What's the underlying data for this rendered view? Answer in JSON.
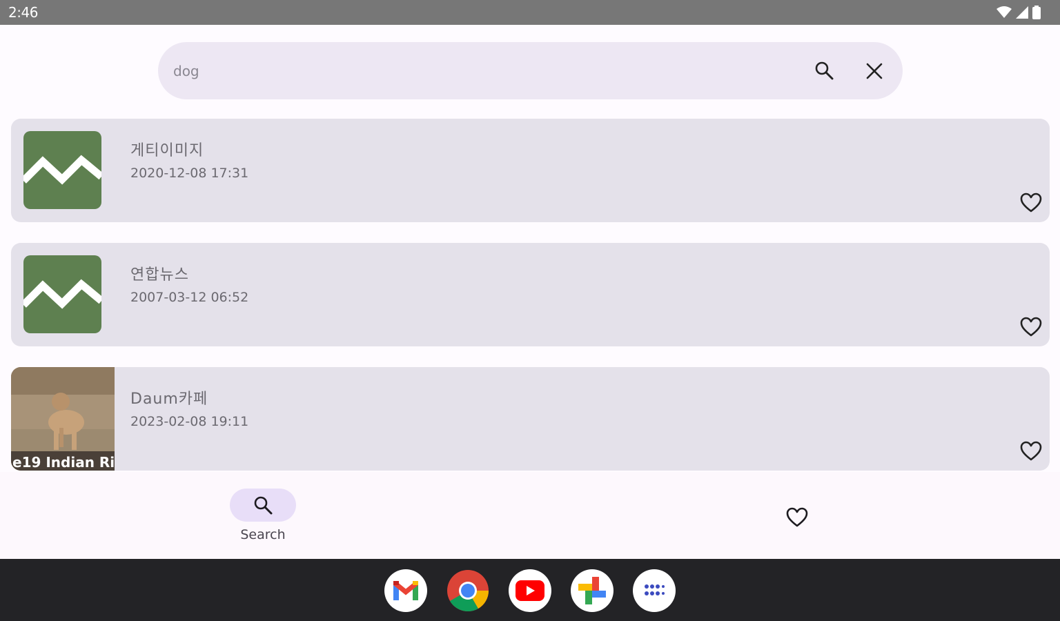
{
  "status_bar": {
    "time": "2:46"
  },
  "search": {
    "query": "dog"
  },
  "results": [
    {
      "title": "게티이미지",
      "date": "2020-12-08 17:31"
    },
    {
      "title": "연합뉴스",
      "date": "2007-03-12 06:52"
    },
    {
      "title": "Daum카페",
      "date": "2023-02-08 19:11",
      "thumb_text": "e19 Indian Ri"
    }
  ],
  "bottom_nav": {
    "search_label": "Search"
  },
  "colors": {
    "status_bar": "#777777",
    "search_bg": "#ede7f3",
    "card_bg": "#e4e1ea",
    "placeholder_thumb": "#5e8050",
    "nav_pill": "#e8def8",
    "taskbar": "#232326"
  },
  "dock": [
    "gmail-icon",
    "chrome-icon",
    "youtube-icon",
    "photos-icon",
    "app-drawer-icon"
  ]
}
